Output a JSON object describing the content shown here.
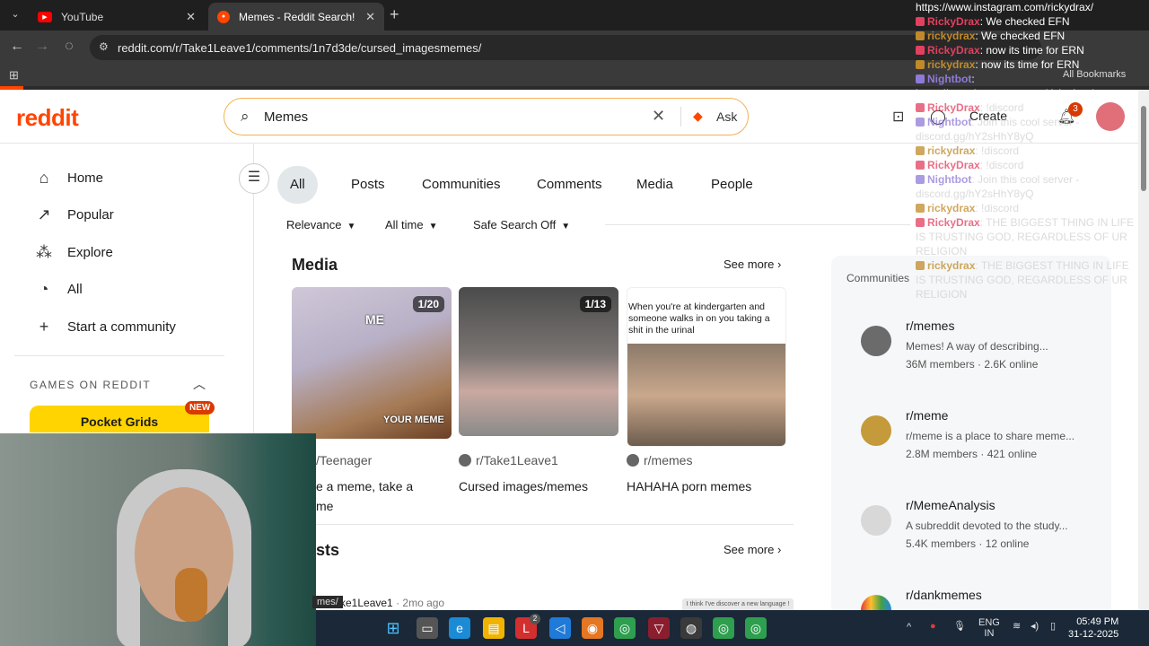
{
  "browser": {
    "tabs": [
      {
        "title": "YouTube",
        "active": false
      },
      {
        "title": "Memes - Reddit Search!",
        "active": true
      }
    ],
    "url": "reddit.com/r/Take1Leave1/comments/1n7d3de/cursed_imagesmemes/",
    "bookmarks_label": "All Bookmarks"
  },
  "reddit": {
    "logo": "reddit",
    "search_value": "Memes",
    "ask_label": "Ask",
    "create_label": "Create",
    "notification_count": "3",
    "sidebar": {
      "items": [
        {
          "label": "Home",
          "icon": "home-icon"
        },
        {
          "label": "Popular",
          "icon": "popular-icon"
        },
        {
          "label": "Explore",
          "icon": "explore-icon"
        },
        {
          "label": "All",
          "icon": "all-icon"
        },
        {
          "label": "Start a community",
          "icon": "plus-icon"
        }
      ],
      "games_header": "GAMES ON REDDIT",
      "game_name": "Pocket Grids",
      "game_badge": "NEW"
    },
    "tabs": [
      "All",
      "Posts",
      "Communities",
      "Comments",
      "Media",
      "People"
    ],
    "filters": [
      "Relevance",
      "All time",
      "Safe Search Off"
    ],
    "media": {
      "title": "Media",
      "see_more": "See more",
      "cards": [
        {
          "subreddit": "/Teenager",
          "title_line1": "e a meme, take a",
          "title_line2": "me",
          "badge": "1/20",
          "img_text_top": "ME",
          "img_text_bottom": "YOUR MEME"
        },
        {
          "subreddit": "r/Take1Leave1",
          "title_line1": "Cursed images/memes",
          "title_line2": "",
          "badge": "1/13"
        },
        {
          "subreddit": "r/memes",
          "title_line1": "HAHAHA porn memes",
          "title_line2": "",
          "caption": "When you're at kindergarten and someone walks in on you taking a shit in the urinal"
        }
      ]
    },
    "posts": {
      "title": "sts",
      "see_more": "See more",
      "author": "ke1Leave1",
      "age": "· 2mo ago",
      "thumb_text": "I think I've discover a new language !"
    },
    "communities": {
      "header": "Communities",
      "items": [
        {
          "name": "r/memes",
          "desc": "Memes! A way of describing...",
          "members": "36M members",
          "online": "· 2.6K online"
        },
        {
          "name": "r/meme",
          "desc": "r/meme is a place to share meme...",
          "members": "2.8M members",
          "online": "· 421 online"
        },
        {
          "name": "r/MemeAnalysis",
          "desc": "A subreddit devoted to the study...",
          "members": "5.4K members",
          "online": "· 12 online"
        },
        {
          "name": "r/dankmemes",
          "desc": "",
          "members": "",
          "online": ""
        }
      ]
    }
  },
  "chat": [
    {
      "user": "",
      "text": "https://www.instagram.com/rickydrax/",
      "color": "#ffffff",
      "faded": false
    },
    {
      "user": "RickyDrax",
      "text": ": We checked EFN",
      "color": "#e24060",
      "faded": false
    },
    {
      "user": "rickydrax",
      "text": ": We checked EFN",
      "color": "#c08a2a",
      "faded": false
    },
    {
      "user": "RickyDrax",
      "text": ": now its time for ERN",
      "color": "#e24060",
      "faded": false
    },
    {
      "user": "rickydrax",
      "text": ": now its time for ERN",
      "color": "#c08a2a",
      "faded": false
    },
    {
      "user": "Nightbot",
      "text": ":",
      "color": "#8f7ad8",
      "faded": false
    },
    {
      "user": "",
      "text": "https://www.instagram.com/rickydrax/",
      "color": "#ffffff",
      "faded": false
    },
    {
      "user": "RickyDrax",
      "text": ": !discord",
      "color": "#e24060",
      "faded": true
    },
    {
      "user": "Nightbot",
      "text": ": Join this cool server - discord.gg/hY2sHhY8yQ",
      "color": "#8f7ad8",
      "faded": true
    },
    {
      "user": "rickydrax",
      "text": ": !discord",
      "color": "#c08a2a",
      "faded": true
    },
    {
      "user": "RickyDrax",
      "text": ": !discord",
      "color": "#e24060",
      "faded": true
    },
    {
      "user": "Nightbot",
      "text": ": Join this cool server - discord.gg/hY2sHhY8yQ",
      "color": "#8f7ad8",
      "faded": true
    },
    {
      "user": "rickydrax",
      "text": ": !discord",
      "color": "#c08a2a",
      "faded": true
    },
    {
      "user": "RickyDrax",
      "text": ": THE BIGGEST THING IN LIFE IS TRUSTING GOD, REGARDLESS OF UR RELIGION",
      "color": "#e24060",
      "faded": true
    },
    {
      "user": "rickydrax",
      "text": ": THE BIGGEST THING IN LIFE IS TRUSTING GOD, REGARDLESS OF UR RELIGION",
      "color": "#c08a2a",
      "faded": true
    }
  ],
  "webcam_label": "mes/",
  "taskbar": {
    "lang_line1": "ENG",
    "lang_line2": "IN",
    "time": "05:49 PM",
    "date": "31-12-2025",
    "badge": "2"
  }
}
